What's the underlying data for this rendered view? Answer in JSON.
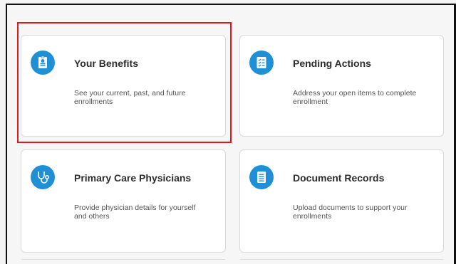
{
  "tiles": [
    {
      "title": "Your Benefits",
      "description": "See your current, past, and future enrollments",
      "icon": "id-badge-icon"
    },
    {
      "title": "Pending Actions",
      "description": "Address your open items to complete enrollment",
      "icon": "checklist-icon"
    },
    {
      "title": "Primary Care Physicians",
      "description": "Provide physician details for yourself and others",
      "icon": "stethoscope-icon"
    },
    {
      "title": "Document Records",
      "description": "Upload documents to support your enrollments",
      "icon": "document-icon"
    }
  ],
  "colors": {
    "icon_bg": "#1f8fd6",
    "highlight": "#e0191b",
    "tile_border": "#d9dadc",
    "title_text": "#2d2d2d"
  }
}
